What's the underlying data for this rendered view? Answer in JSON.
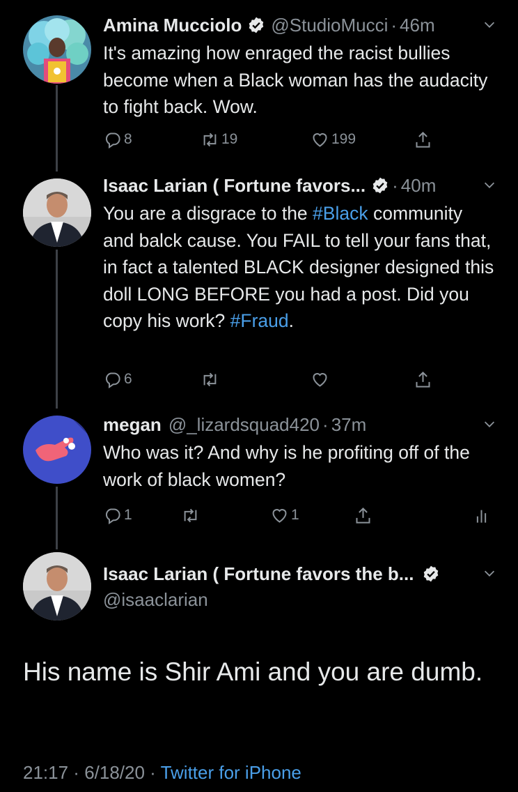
{
  "tweets": [
    {
      "name": "Amina Mucciolo",
      "handle": "@StudioMucci",
      "time": "46m",
      "body": "It's amazing how enraged the racist bullies become when a Black woman has the audacity to fight back. Wow.",
      "replies": "8",
      "retweets": "19",
      "likes": "199"
    },
    {
      "name": "Isaac Larian ( Fortune favors...",
      "time": "40m",
      "body_pre": "You are a disgrace to the ",
      "tag1": "#Black",
      "body_mid": " community and balck cause. You FAIL to tell your fans that, in fact a talented BLACK designer designed this doll LONG BEFORE you had a post. Did you copy his work? ",
      "tag2": "#Fraud",
      "body_post": ".",
      "replies": "6"
    },
    {
      "name": "megan",
      "handle": "@_lizardsquad420",
      "time": "37m",
      "body": "Who was it? And why is he profiting off of the work of black women?",
      "replies": "1",
      "likes": "1"
    }
  ],
  "focus": {
    "name": "Isaac Larian ( Fortune favors the b...",
    "handle": "@isaaclarian",
    "text": "His name is Shir Ami and you are dumb.",
    "time": "21:17",
    "date": "6/18/20",
    "source": "Twitter for iPhone"
  },
  "colors": {
    "background": "#000000",
    "text": "#e7e9ea",
    "muted": "#8b9299",
    "link": "#4a9fe9"
  },
  "icons": [
    "verified-icon",
    "chevron-down-icon",
    "reply-icon",
    "retweet-icon",
    "like-icon",
    "share-icon",
    "analytics-icon"
  ]
}
